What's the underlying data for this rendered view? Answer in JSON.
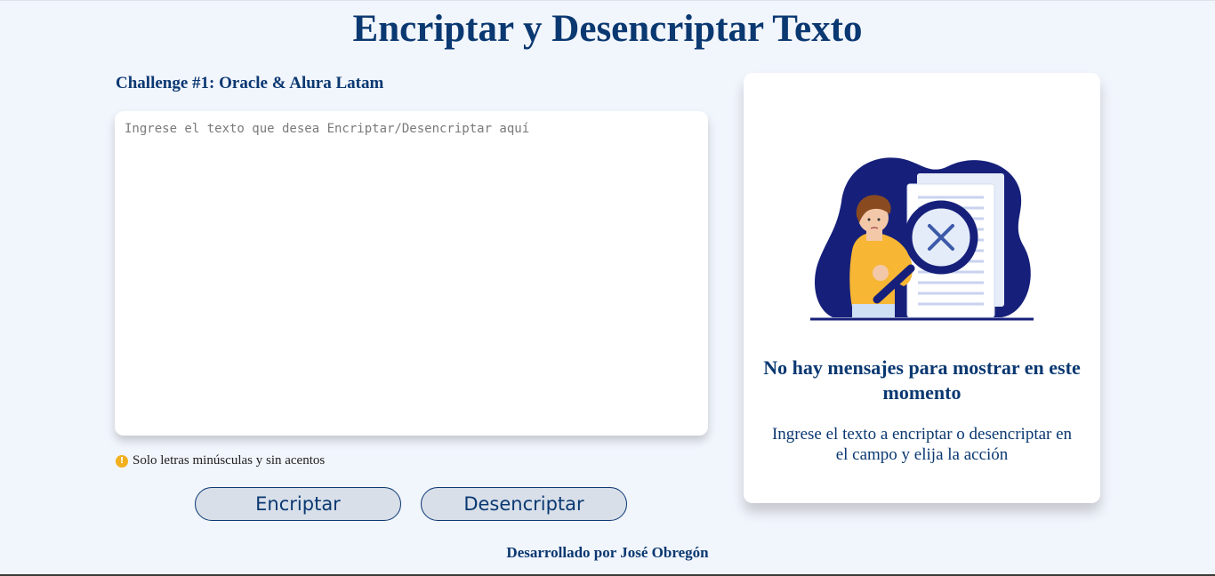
{
  "header": {
    "title": "Encriptar y Desencriptar Texto"
  },
  "challenge": "Challenge #1: Oracle & Alura Latam",
  "input": {
    "placeholder": "Ingrese el texto que desea Encriptar/Desencriptar aquí",
    "value": ""
  },
  "hint": {
    "icon": "exclamation-icon",
    "text": "Solo letras minúsculas y sin acentos"
  },
  "buttons": {
    "encrypt": "Encriptar",
    "decrypt": "Desencriptar"
  },
  "output": {
    "title": "No hay mensajes para mostrar en este momento",
    "text": "Ingrese el texto a encriptar o desencriptar en el campo y elija la acción"
  },
  "footer": "Desarrollado por José Obregón",
  "colors": {
    "accent": "#0a3871",
    "background": "#f1f5fc",
    "warning": "#f2b01e"
  }
}
